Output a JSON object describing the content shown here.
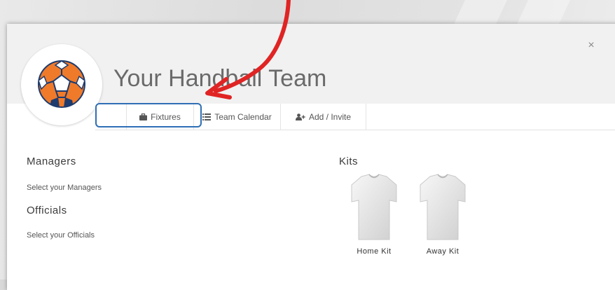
{
  "header": {
    "team_name": "Your Handball Team",
    "close_glyph": "×"
  },
  "tabs": [
    {
      "label": "Fixtures",
      "icon": "briefcase-icon"
    },
    {
      "label": "Team Calendar",
      "icon": "list-icon"
    },
    {
      "label": "Add / Invite",
      "icon": "add-user-icon"
    }
  ],
  "managers": {
    "title": "Managers",
    "placeholder": "Select your Managers"
  },
  "officials": {
    "title": "Officials",
    "placeholder": "Select your Officials"
  },
  "kits": {
    "title": "Kits",
    "items": [
      {
        "label": "Home Kit"
      },
      {
        "label": "Away Kit"
      }
    ]
  },
  "colors": {
    "accent_blue": "#2f6fb5",
    "arrow_red": "#e02424",
    "ball_orange": "#ef7a2a",
    "ball_navy": "#1d3b6e"
  }
}
